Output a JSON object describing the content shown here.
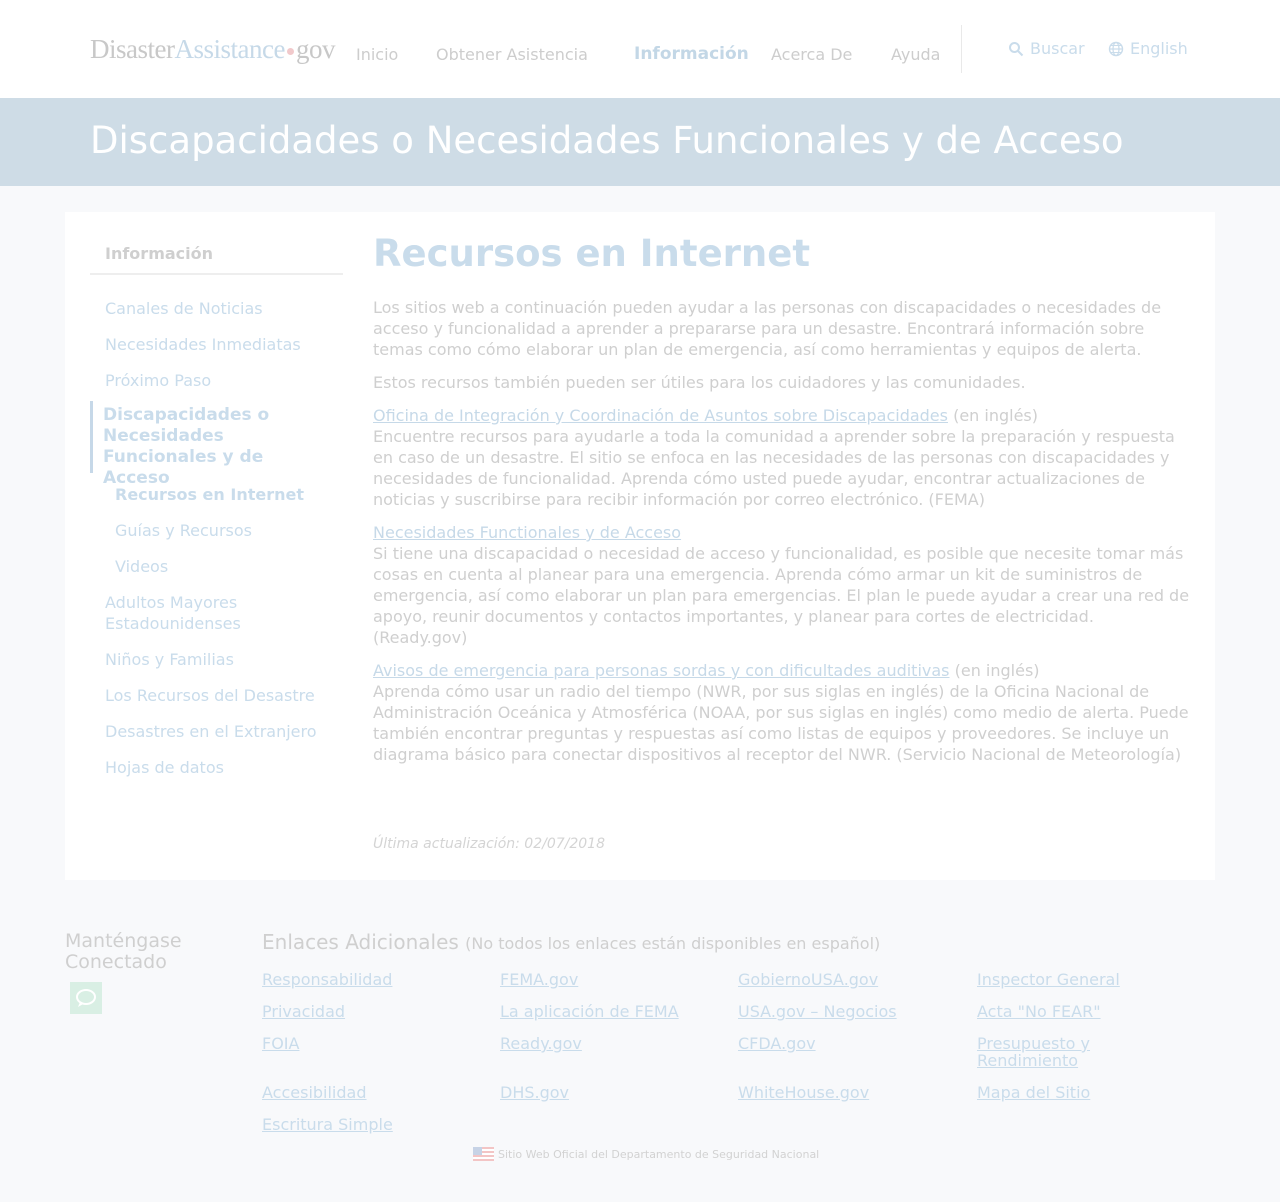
{
  "header": {
    "logo": {
      "part1": "Disaster",
      "part2": "Assistance",
      "part3": "gov"
    },
    "nav": [
      {
        "label": "Inicio"
      },
      {
        "label": "Obtener Asistencia"
      },
      {
        "label": "Información",
        "active": true
      },
      {
        "label": "Acerca De"
      },
      {
        "label": "Ayuda"
      }
    ],
    "search_label": "Buscar",
    "language_label": "English"
  },
  "banner": {
    "title": "Discapacidades o Necesidades Funcionales y de Acceso"
  },
  "sidebar": {
    "title": "Información",
    "items": [
      {
        "label": "Canales de Noticias"
      },
      {
        "label": "Necesidades Inmediatas"
      },
      {
        "label": "Próximo Paso"
      },
      {
        "label": "Discapacidades o Necesidades Funcionales y de Acceso",
        "active": true
      },
      {
        "label": "Recursos en Internet",
        "sub": true,
        "current": true
      },
      {
        "label": "Guías y Recursos",
        "sub": true
      },
      {
        "label": "Videos",
        "sub": true
      },
      {
        "label": "Adultos Mayores Estadounidenses"
      },
      {
        "label": "Niños y Familias"
      },
      {
        "label": "Los Recursos del Desastre"
      },
      {
        "label": "Desastres en el Extranjero"
      },
      {
        "label": "Hojas de datos"
      }
    ]
  },
  "content": {
    "title": "Recursos en Internet",
    "intro": "Los sitios web a continuación pueden ayudar a las personas con discapacidades o necesidades de acceso y funcionalidad a aprender a prepararse para un desastre. Encontrará información sobre temas como cómo elaborar un plan de emergencia, así como herramientas y equipos de alerta.",
    "intro2": "Estos recursos también pueden ser útiles para los cuidadores y las comunidades.",
    "resources": [
      {
        "link": "Oficina de Integración y Coordinación de Asuntos sobre Discapacidades",
        "note": " (en inglés)",
        "desc": "Encuentre recursos para ayudarle a toda la comunidad a aprender sobre la preparación y respuesta en caso de un desastre. El sitio se enfoca en las necesidades de las personas con discapacidades y necesidades de funcionalidad. Aprenda cómo usted puede ayudar, encontrar actualizaciones de noticias y suscribirse para recibir información por correo electrónico. (FEMA)"
      },
      {
        "link": "Necesidades Functionales y de Acceso",
        "note": "",
        "desc": "Si tiene una discapacidad o necesidad de acceso y funcionalidad, es posible que necesite tomar más cosas en cuenta al planear para una emergencia. Aprenda cómo armar un kit de suministros de emergencia, así como elaborar un plan para emergencias. El plan le puede ayudar a crear una red de apoyo, reunir documentos y contactos importantes, y planear para cortes de electricidad. (Ready.gov)"
      },
      {
        "link": "Avisos de emergencia para personas sordas y con dificultades auditivas",
        "note": " (en inglés)",
        "desc": "Aprenda cómo usar un radio del tiempo (NWR, por sus siglas en inglés) de la Oficina Nacional de Administración Oceánica y Atmosférica (NOAA, por sus siglas en inglés) como medio de alerta. Puede también encontrar preguntas y respuestas así como listas de equipos y proveedores. Se incluye un diagrama básico para conectar dispositivos al receptor del NWR. (Servicio Nacional de Meteorología)"
      }
    ],
    "updated": "Última actualización: 02/07/2018"
  },
  "footer": {
    "stay_connected": "Manténgase Conectado",
    "links_title": "Enlaces Adicionales",
    "links_note": "(No todos los enlaces están disponibles en español)",
    "links": [
      "Responsabilidad",
      "FEMA.gov",
      "GobiernoUSA.gov",
      "Inspector General",
      "Privacidad",
      "La aplicación de FEMA",
      "USA.gov – Negocios",
      "Acta \"No FEAR\"",
      "FOIA",
      "Ready.gov",
      "CFDA.gov",
      "Presupuesto y Rendimiento",
      "Accesibilidad",
      "DHS.gov",
      "WhiteHouse.gov",
      "Mapa del Sitio",
      "Escritura Simple"
    ],
    "seal_text": "Sitio Web Oficial del Departamento de Seguridad Nacional"
  },
  "colors": {
    "banner": "#cedce6",
    "link": "#c6d9e8",
    "text": "#cfcfcf",
    "chat_icon_bg": "#d9efe4"
  }
}
